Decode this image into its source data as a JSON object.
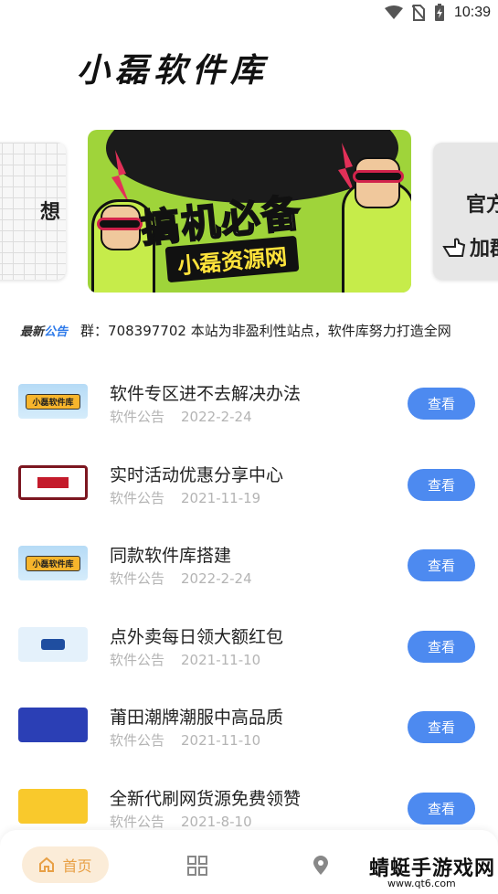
{
  "status_bar": {
    "time": "10:39"
  },
  "app": {
    "title": "小磊软件库"
  },
  "banners": {
    "left_partial_text": "想",
    "center_headline": "搞机必备",
    "center_subline": "小磊资源网",
    "right_partial_text_1": "官方",
    "right_partial_text_2": "加群"
  },
  "notice": {
    "badge_prefix": "最新",
    "badge_accent": "公告",
    "text": "群：708397702 本站为非盈利性站点，软件库努力打造全网"
  },
  "articles": [
    {
      "title": "软件专区进不去解决办法",
      "category": "软件公告",
      "date": "2022-2-24",
      "button": "查看",
      "thumb_text": "小磊软件库"
    },
    {
      "title": "实时活动优惠分享中心",
      "category": "软件公告",
      "date": "2021-11-19",
      "button": "查看",
      "thumb_text": ""
    },
    {
      "title": "同款软件库搭建",
      "category": "软件公告",
      "date": "2022-2-24",
      "button": "查看",
      "thumb_text": "小磊软件库"
    },
    {
      "title": "点外卖每日领大额红包",
      "category": "软件公告",
      "date": "2021-11-10",
      "button": "查看",
      "thumb_text": ""
    },
    {
      "title": "莆田潮牌潮服中高品质",
      "category": "软件公告",
      "date": "2021-11-10",
      "button": "查看",
      "thumb_text": ""
    },
    {
      "title": "全新代刷网货源免费领赞",
      "category": "软件公告",
      "date": "2021-8-10",
      "button": "查看",
      "thumb_text": ""
    }
  ],
  "bottom_nav": {
    "home_label": "首页"
  },
  "watermark": {
    "text": "蜻蜓手游戏网",
    "url": "www.qt6.com"
  },
  "colors": {
    "accent_blue": "#4d8af0",
    "home_tab_bg": "#fbecd8",
    "home_tab_fg": "#e8a046"
  }
}
